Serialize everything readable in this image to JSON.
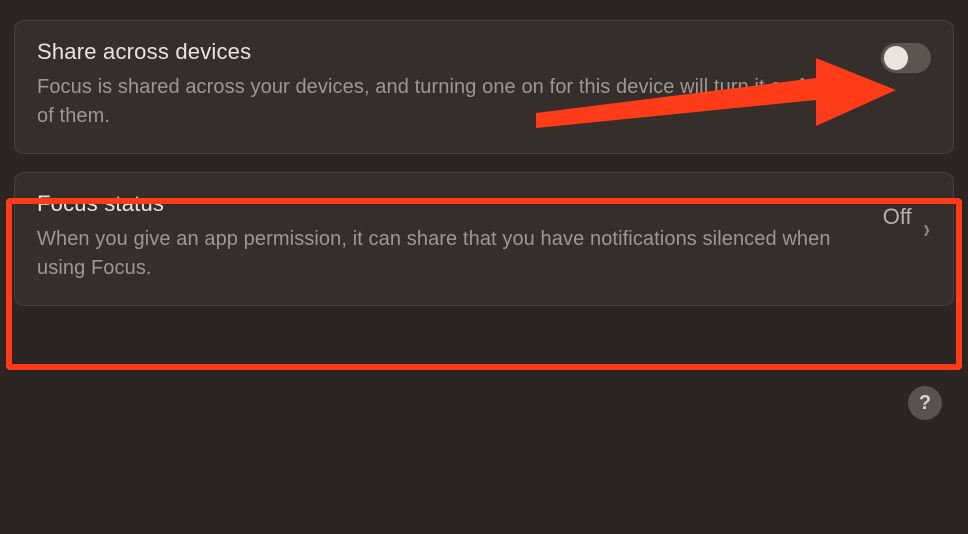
{
  "share_devices": {
    "title": "Share across devices",
    "description": "Focus is shared across your devices, and turning one on for this device will turn it on for all of them.",
    "toggle_on": false
  },
  "focus_status": {
    "title": "Focus status",
    "description": "When you give an app permission, it can share that you have notifications silenced when using Focus.",
    "value": "Off"
  },
  "help_label": "?"
}
